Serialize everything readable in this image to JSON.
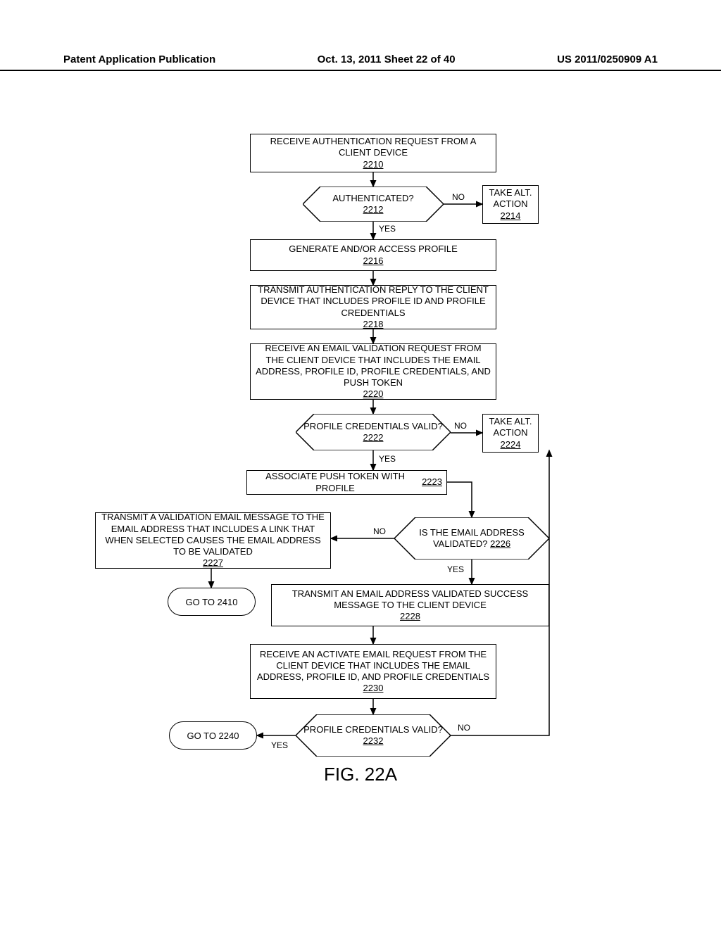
{
  "header": {
    "left": "Patent Application Publication",
    "center": "Oct. 13, 2011  Sheet 22 of 40",
    "right": "US 2011/0250909 A1"
  },
  "nodes": {
    "n2210": {
      "text": "RECEIVE AUTHENTICATION REQUEST FROM A CLIENT DEVICE",
      "ref": "2210"
    },
    "n2212": {
      "text": "AUTHENTICATED?",
      "ref": "2212"
    },
    "n2214": {
      "text": "TAKE ALT. ACTION",
      "ref": "2214"
    },
    "n2216": {
      "text": "GENERATE AND/OR ACCESS PROFILE",
      "ref": "2216"
    },
    "n2218": {
      "text": "TRANSMIT AUTHENTICATION REPLY TO THE CLIENT DEVICE THAT INCLUDES PROFILE ID AND PROFILE CREDENTIALS",
      "ref": "2218"
    },
    "n2220": {
      "text": "RECEIVE AN EMAIL VALIDATION REQUEST FROM THE CLIENT DEVICE THAT INCLUDES THE EMAIL ADDRESS, PROFILE ID, PROFILE CREDENTIALS, AND PUSH TOKEN",
      "ref": "2220"
    },
    "n2222": {
      "text": "PROFILE CREDENTIALS VALID?",
      "ref": "2222"
    },
    "n2224": {
      "text": "TAKE ALT. ACTION",
      "ref": "2224"
    },
    "n2223": {
      "text": "ASSOCIATE PUSH TOKEN WITH PROFILE",
      "ref": "2223"
    },
    "n2226": {
      "text": "IS THE EMAIL ADDRESS VALIDATED?",
      "ref": "2226"
    },
    "n2227": {
      "text": "TRANSMIT A VALIDATION EMAIL MESSAGE TO THE EMAIL ADDRESS THAT INCLUDES A LINK THAT WHEN SELECTED CAUSES THE EMAIL ADDRESS TO BE VALIDATED",
      "ref": "2227"
    },
    "t2410": {
      "text": "GO TO 2410"
    },
    "n2228": {
      "text": "TRANSMIT AN EMAIL ADDRESS VALIDATED SUCCESS MESSAGE TO THE CLIENT DEVICE",
      "ref": "2228"
    },
    "n2230": {
      "text": "RECEIVE AN ACTIVATE EMAIL REQUEST FROM THE CLIENT DEVICE THAT INCLUDES THE EMAIL ADDRESS, PROFILE ID, AND PROFILE CREDENTIALS",
      "ref": "2230"
    },
    "n2232": {
      "text": "PROFILE CREDENTIALS VALID?",
      "ref": "2232"
    },
    "t2240": {
      "text": "GO TO 2240"
    }
  },
  "labels": {
    "yes": "YES",
    "no": "NO"
  },
  "figure": "FIG. 22A"
}
